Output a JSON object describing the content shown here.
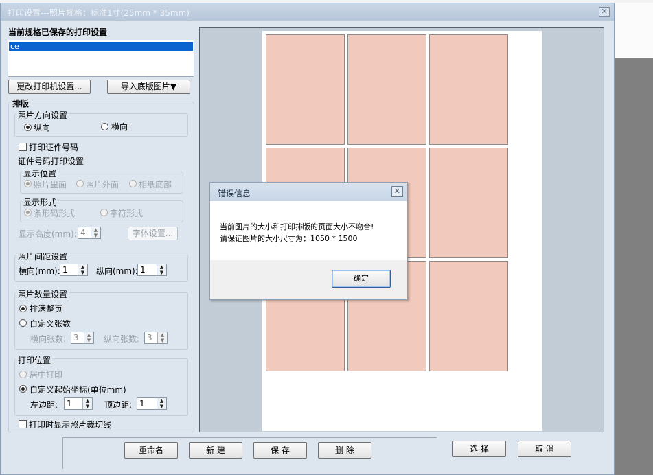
{
  "window": {
    "title": "打印设置---照片规格：标准1寸(25mm * 35mm)",
    "close_glyph": "✕"
  },
  "saved_settings": {
    "heading": "当前规格已保存的打印设置",
    "items": [
      "ce"
    ]
  },
  "buttons": {
    "printer_settings": "更改打印机设置...",
    "import_base": "导入底版图片▼"
  },
  "layout_section": {
    "heading": "排版",
    "orientation": {
      "label": "照片方向设置",
      "portrait": "纵向",
      "landscape": "横向",
      "selected": "纵向"
    },
    "print_id_checkbox": "打印证件号码",
    "id_settings": {
      "label": "证件号码打印设置",
      "position": {
        "label": "显示位置",
        "options": [
          "照片里面",
          "照片外面",
          "相纸底部"
        ]
      },
      "format": {
        "label": "显示形式",
        "options": [
          "条形码形式",
          "字符形式"
        ]
      },
      "height_label": "显示高度(mm):",
      "height_value": "4",
      "font_button": "字体设置..."
    },
    "spacing": {
      "label": "照片间距设置",
      "horizontal_label": "横向(mm):",
      "horizontal_value": "1",
      "vertical_label": "纵向(mm):",
      "vertical_value": "1"
    },
    "count": {
      "label": "照片数量设置",
      "fill_page": "排满整页",
      "custom": "自定义张数",
      "h_count_label": "横向张数:",
      "h_count_value": "3",
      "v_count_label": "纵向张数:",
      "v_count_value": "3"
    },
    "print_position": {
      "label": "打印位置",
      "center": "居中打印",
      "custom": "自定义起始坐标(单位mm)",
      "left_label": "左边距:",
      "left_value": "1",
      "top_label": "顶边距:",
      "top_value": "1"
    },
    "show_cut_lines": "打印时显示照片裁切线"
  },
  "bottom_buttons": {
    "rename": "重命名",
    "new": "新  建",
    "save": "保  存",
    "delete": "删  除",
    "select": "选  择",
    "cancel": "取  消"
  },
  "preview": {
    "columns": 3,
    "rows": 3,
    "photo_color": "#f2c9bd"
  },
  "error_dialog": {
    "title": "错误信息",
    "close_glyph": "✕",
    "message_line1": "当前图片的大小和打印排版的页面大小不吻合!",
    "message_line2": "请保证图片的大小尺寸为：1050 * 1500",
    "ok_button": "确定"
  }
}
